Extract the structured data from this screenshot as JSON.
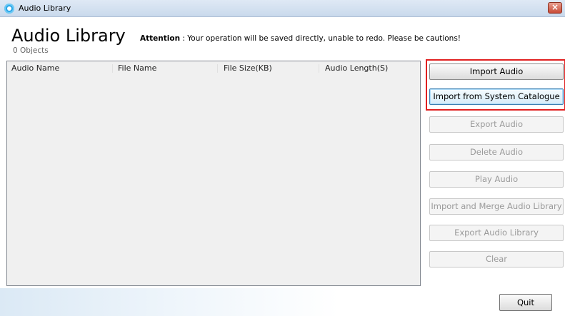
{
  "window": {
    "title": "Audio Library",
    "close_label": "×",
    "app_icon": "app-logo-icon",
    "close_icon": "close-icon"
  },
  "header": {
    "heading": "Audio Library",
    "attention_label": "Attention",
    "attention_text": " : Your operation will be saved directly, unable to redo. Please be cautions!",
    "object_count": "0 Objects"
  },
  "list": {
    "columns": [
      "Audio Name",
      "File Name",
      "File Size(KB)",
      "Audio Length(S)"
    ],
    "rows": []
  },
  "buttons": {
    "import_audio": "Import Audio",
    "import_system_catalogue": "Import from System Catalogue",
    "export_audio": "Export Audio",
    "delete_audio": "Delete Audio",
    "play_audio": "Play Audio",
    "import_merge_library": "Import and Merge Audio Library",
    "export_library": "Export Audio Library",
    "clear": "Clear",
    "quit": "Quit"
  },
  "colors": {
    "highlight": "#e02020",
    "focus_border": "#3c7fb1",
    "titlebar": "#c9d9ec"
  }
}
